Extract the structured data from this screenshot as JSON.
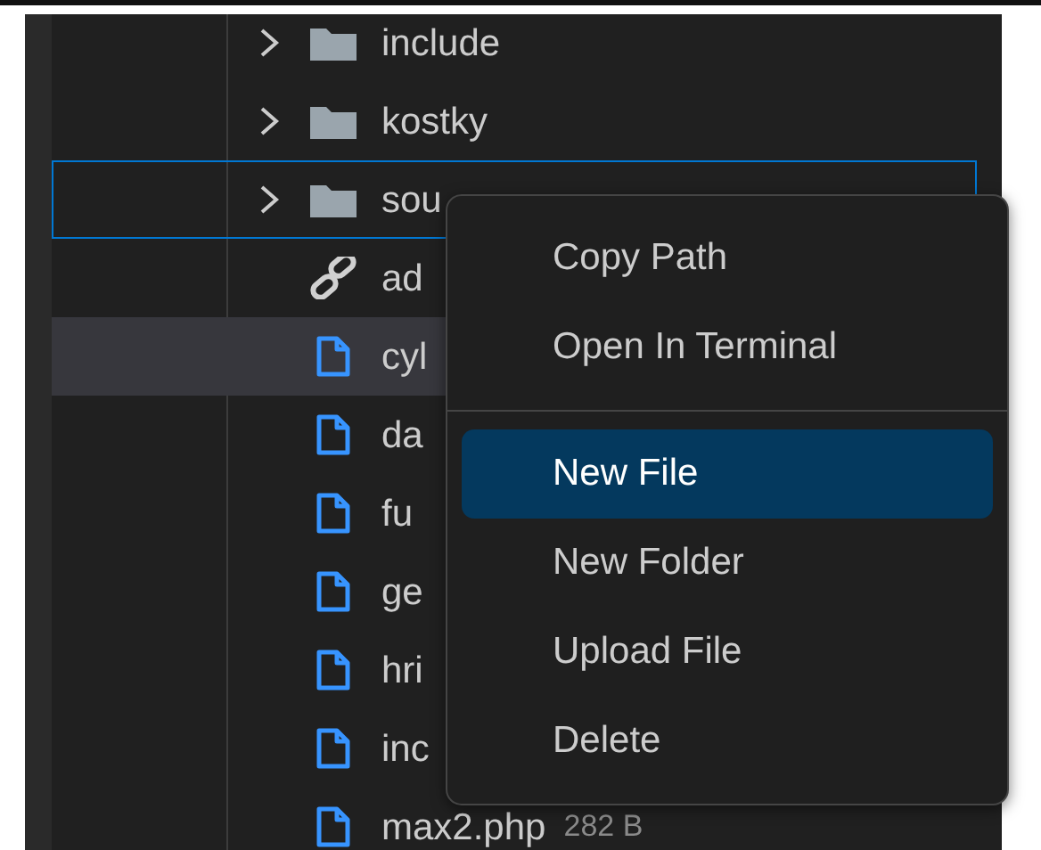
{
  "tree": {
    "items": [
      {
        "kind": "folder",
        "name": "include",
        "expanded": false,
        "selected": false,
        "hovered": false
      },
      {
        "kind": "folder",
        "name": "kostky",
        "expanded": false,
        "selected": false,
        "hovered": false
      },
      {
        "kind": "folder",
        "name": "sou",
        "expanded": false,
        "selected": true,
        "hovered": false
      },
      {
        "kind": "link",
        "name": "ad",
        "selected": false,
        "hovered": false
      },
      {
        "kind": "file",
        "name": "cyl",
        "selected": false,
        "hovered": true
      },
      {
        "kind": "file",
        "name": "da",
        "selected": false,
        "hovered": false
      },
      {
        "kind": "file",
        "name": "fu",
        "selected": false,
        "hovered": false
      },
      {
        "kind": "file",
        "name": "ge",
        "selected": false,
        "hovered": false
      },
      {
        "kind": "file",
        "name": "hri",
        "selected": false,
        "hovered": false
      },
      {
        "kind": "file",
        "name": "inc",
        "selected": false,
        "hovered": false
      },
      {
        "kind": "file",
        "name": "max2.php",
        "size": "282 B",
        "selected": false,
        "hovered": false
      }
    ]
  },
  "context_menu": {
    "items": [
      {
        "kind": "item",
        "label": "Copy Path",
        "selected": false
      },
      {
        "kind": "item",
        "label": "Open In Terminal",
        "selected": false
      },
      {
        "kind": "separator"
      },
      {
        "kind": "item",
        "label": "New File",
        "selected": true
      },
      {
        "kind": "item",
        "label": "New Folder",
        "selected": false
      },
      {
        "kind": "item",
        "label": "Upload File",
        "selected": false
      },
      {
        "kind": "item",
        "label": "Delete",
        "selected": false
      }
    ]
  }
}
